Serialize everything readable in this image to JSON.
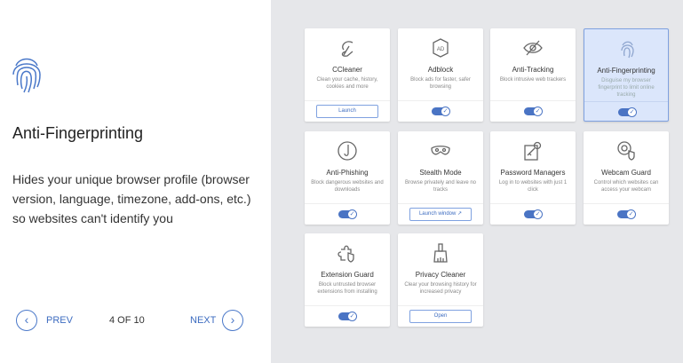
{
  "info": {
    "title": "Anti-Fingerprinting",
    "description": "Hides your unique browser profile (browser version, language, timezone, add-ons, etc.) so websites can't identify you",
    "prev": "PREV",
    "next": "NEXT",
    "counter": "4 OF 10"
  },
  "accent": "#4a74c4",
  "cards": [
    {
      "name": "CCleaner",
      "desc": "Clean your cache, history, cookies and more",
      "action": "button",
      "label": "Launch",
      "icon": "broom-c-icon"
    },
    {
      "name": "Adblock",
      "desc": "Block ads for faster, safer browsing",
      "action": "toggle",
      "on": true,
      "icon": "ad-icon"
    },
    {
      "name": "Anti-Tracking",
      "desc": "Block intrusive web trackers",
      "action": "toggle",
      "on": true,
      "icon": "eye-off-icon"
    },
    {
      "name": "Anti-Fingerprinting",
      "desc": "Disguise my browser fingerprint to limit online tracking",
      "action": "toggle",
      "on": true,
      "selected": true,
      "icon": "fingerprint-icon"
    },
    {
      "name": "Anti-Phishing",
      "desc": "Block dangerous websites and downloads",
      "action": "toggle",
      "on": true,
      "icon": "hook-icon"
    },
    {
      "name": "Stealth Mode",
      "desc": "Browse privately and leave no tracks",
      "action": "button",
      "label": "Launch window ↗",
      "icon": "mask-icon"
    },
    {
      "name": "Password Managers",
      "desc": "Log in to websites with just 1 click",
      "action": "toggle",
      "on": true,
      "icon": "key-icon"
    },
    {
      "name": "Webcam Guard",
      "desc": "Control which websites can access your webcam",
      "action": "toggle",
      "on": true,
      "icon": "webcam-shield-icon"
    },
    {
      "name": "Extension Guard",
      "desc": "Block untrusted browser extensions from installing",
      "action": "toggle",
      "on": true,
      "icon": "puzzle-shield-icon"
    },
    {
      "name": "Privacy Cleaner",
      "desc": "Clear your browsing history for increased privacy",
      "action": "button",
      "label": "Open",
      "icon": "brush-icon"
    }
  ]
}
